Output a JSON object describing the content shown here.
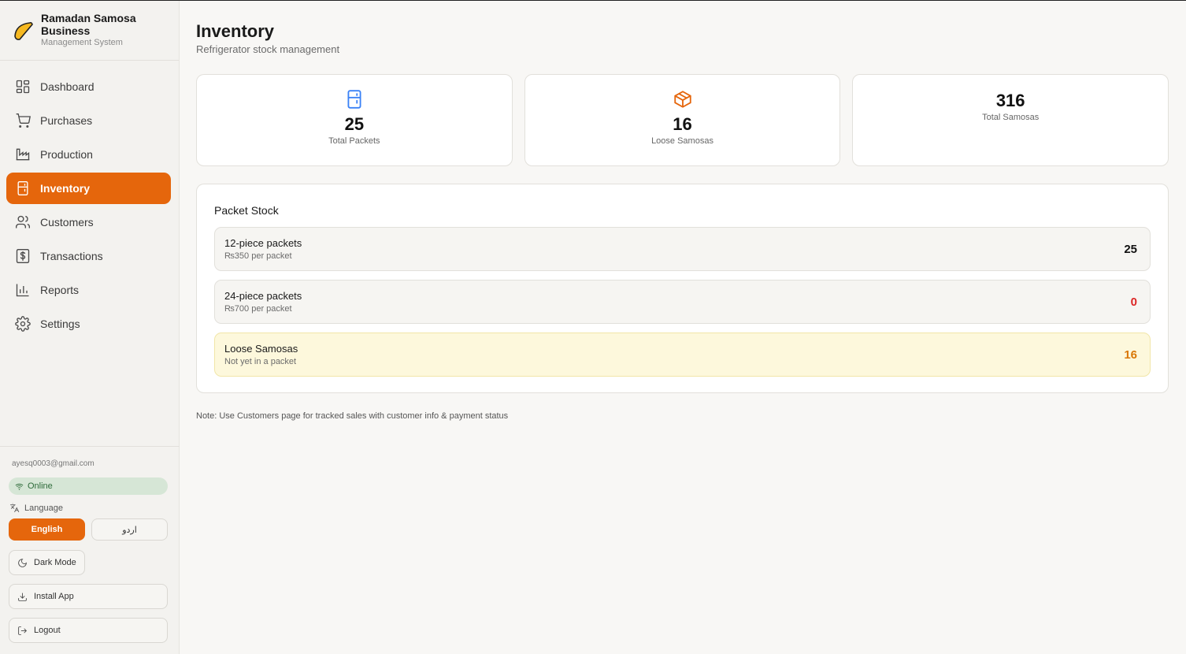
{
  "brand": {
    "title": "Ramadan Samosa Business",
    "subtitle": "Management System"
  },
  "nav": [
    {
      "label": "Dashboard",
      "icon": "dashboard-icon",
      "active": false
    },
    {
      "label": "Purchases",
      "icon": "cart-icon",
      "active": false
    },
    {
      "label": "Production",
      "icon": "factory-icon",
      "active": false
    },
    {
      "label": "Inventory",
      "icon": "refrigerator-icon",
      "active": true
    },
    {
      "label": "Customers",
      "icon": "users-icon",
      "active": false
    },
    {
      "label": "Transactions",
      "icon": "dollar-icon",
      "active": false
    },
    {
      "label": "Reports",
      "icon": "bar-chart-icon",
      "active": false
    },
    {
      "label": "Settings",
      "icon": "gear-icon",
      "active": false
    }
  ],
  "account": {
    "email": "ayesq0003@gmail.com",
    "status": "Online",
    "language_label": "Language",
    "languages": [
      {
        "label": "English",
        "active": true
      },
      {
        "label": "اردو",
        "active": false
      }
    ],
    "dark_mode_label": "Dark Mode",
    "install_label": "Install App",
    "logout_label": "Logout"
  },
  "page": {
    "title": "Inventory",
    "subtitle": "Refrigerator stock management"
  },
  "stats": [
    {
      "value": "25",
      "label": "Total Packets",
      "icon": "refrigerator-icon",
      "color": "#3b82f6"
    },
    {
      "value": "16",
      "label": "Loose Samosas",
      "icon": "package-icon",
      "color": "#e5660c"
    },
    {
      "value": "316",
      "label": "Total Samosas"
    }
  ],
  "packet_stock": {
    "title": "Packet Stock",
    "rows": [
      {
        "name": "12-piece packets",
        "sub": "₨350 per packet",
        "count": "25",
        "color": "#111111"
      },
      {
        "name": "24-piece packets",
        "sub": "₨700 per packet",
        "count": "0",
        "color": "#dc2626"
      },
      {
        "name": "Loose Samosas",
        "sub": "Not yet in a packet",
        "count": "16",
        "color": "#d97706"
      }
    ]
  },
  "note": "Note: Use Customers page for tracked sales with customer info & payment status",
  "colors": {
    "accent": "#e5660c",
    "online_bg": "#d6e6d6",
    "loose_bg": "#fdf8dc"
  }
}
